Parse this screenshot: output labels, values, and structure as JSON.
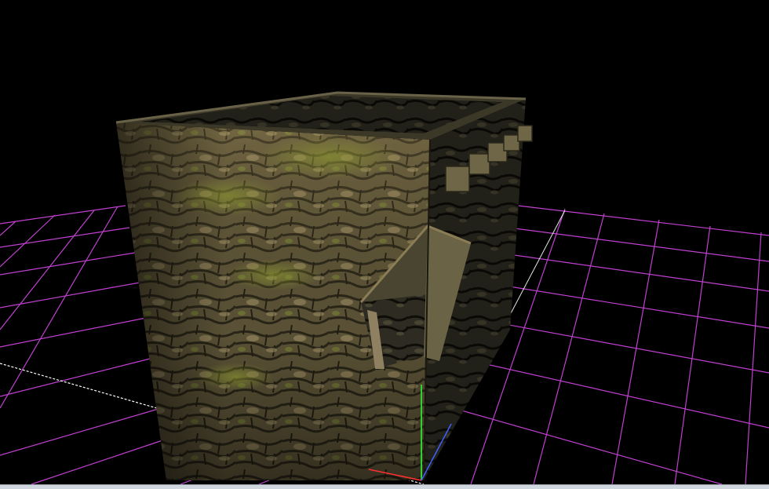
{
  "viewport": {
    "background": "#000000",
    "grid_color": "#c040d0",
    "axis_colors": {
      "x": "#ff3030",
      "y": "#30d030",
      "z": "#4060ff",
      "reference": "#ffffff"
    },
    "object": "stone-tower-model"
  },
  "colors": {
    "stone_light": "#8a7a55",
    "stone_dark": "#2c2a1c",
    "moss": "#7d8a2e",
    "statusbar": "#cfd6dd"
  }
}
